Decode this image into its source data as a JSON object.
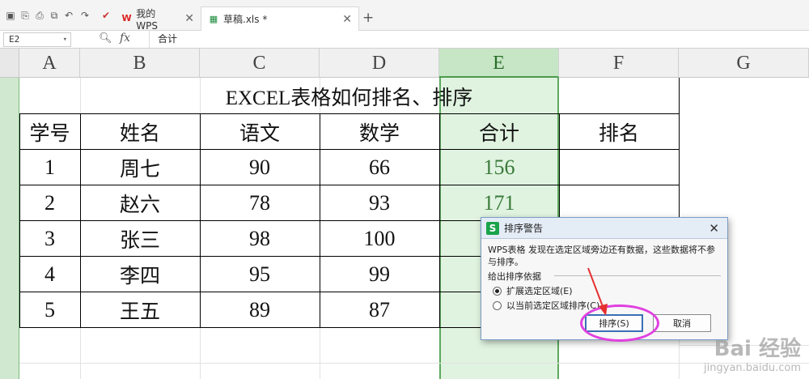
{
  "tabs": [
    {
      "label": "我的WPS",
      "icon": "wps-logo-icon"
    },
    {
      "label": "草稿.xls *",
      "icon": "spreadsheet-icon"
    }
  ],
  "formula_bar": {
    "cell_ref": "E2",
    "fx": "fx",
    "content": "合计"
  },
  "columns": [
    "A",
    "B",
    "C",
    "D",
    "E",
    "F",
    "G"
  ],
  "table": {
    "title": "EXCEL表格如何排名、排序",
    "headers": [
      "学号",
      "姓名",
      "语文",
      "数学",
      "合计",
      "排名"
    ],
    "rows": [
      [
        "1",
        "周七",
        "90",
        "66",
        "156",
        ""
      ],
      [
        "2",
        "赵六",
        "78",
        "93",
        "171",
        ""
      ],
      [
        "3",
        "张三",
        "98",
        "100",
        "",
        ""
      ],
      [
        "4",
        "李四",
        "95",
        "99",
        "",
        ""
      ],
      [
        "5",
        "王五",
        "89",
        "87",
        "",
        ""
      ]
    ]
  },
  "dialog": {
    "title": "排序警告",
    "message": "WPS表格 发现在选定区域旁边还有数据，这些数据将不参与排序。",
    "group_label": "给出排序依据",
    "option_expand": "扩展选定区域(E)",
    "option_current": "以当前选定区域排序(C)",
    "sort_button": "排序(S)",
    "cancel_button": "取消",
    "selected_option": "expand"
  },
  "watermark": {
    "brand": "Bai 经验",
    "url": "jingyan.baidu.com"
  },
  "colors": {
    "selection": "#5ea85e",
    "highlight_ellipse": "#e040e0",
    "arrow": "#e53030"
  }
}
